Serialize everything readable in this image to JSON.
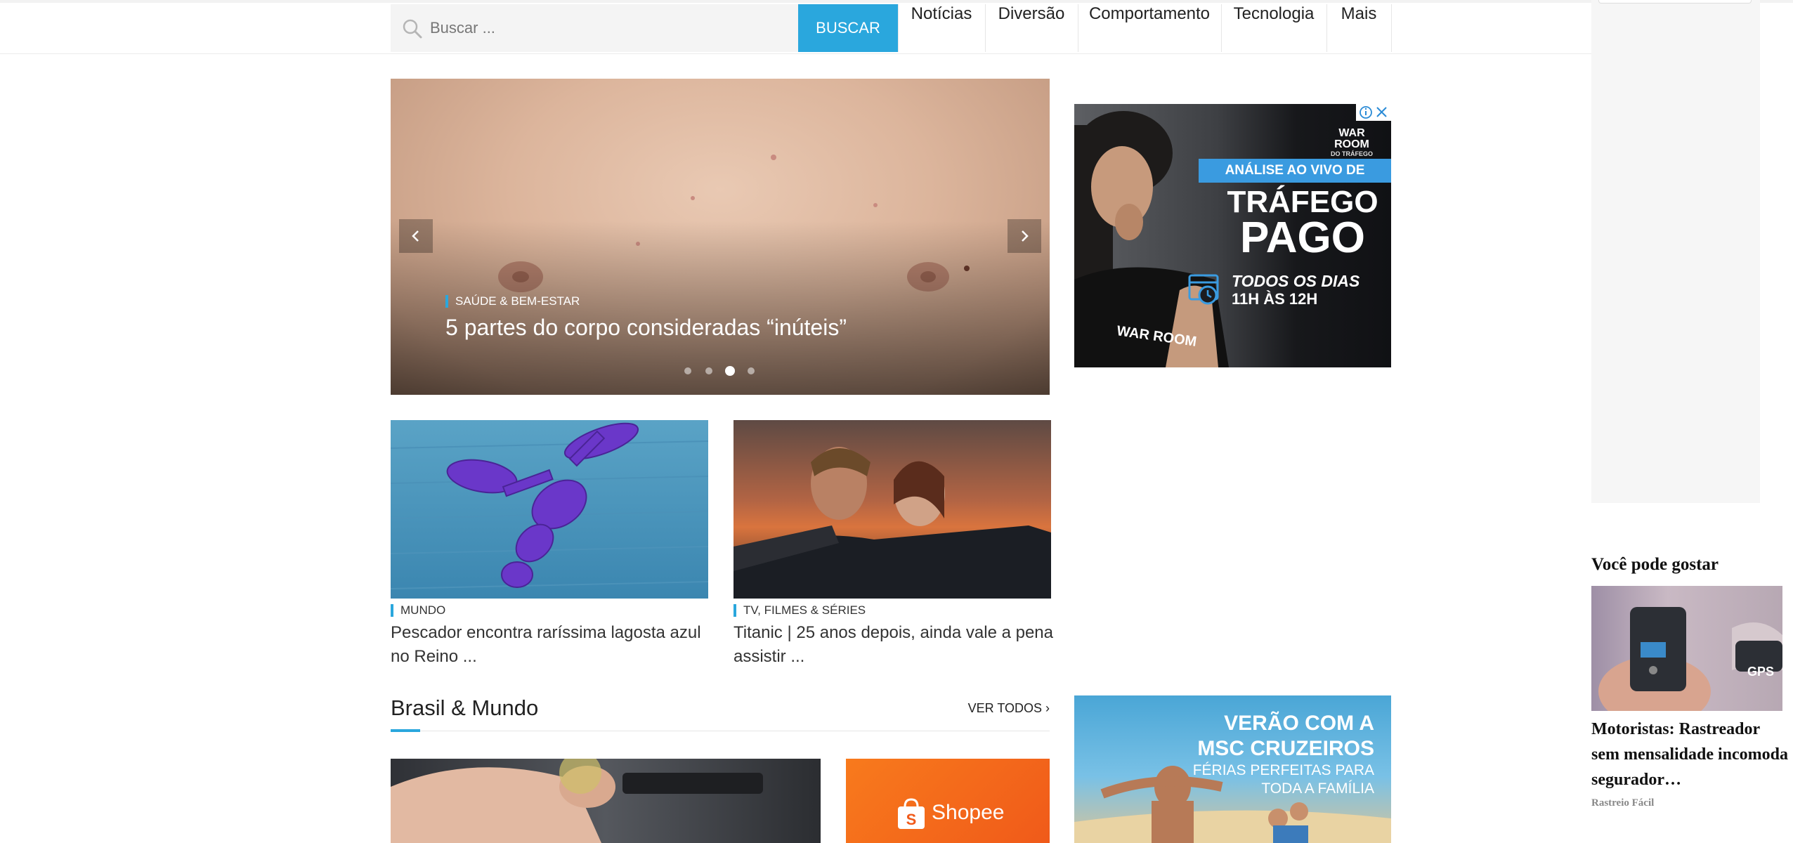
{
  "search": {
    "placeholder": "Buscar ...",
    "button_label": "BUSCAR"
  },
  "nav": {
    "items": [
      "Notícias",
      "Diversão",
      "Comportamento",
      "Tecnologia",
      "Mais"
    ]
  },
  "slider": {
    "category": "SAÚDE & BEM-ESTAR",
    "title": "5 partes do corpo consideradas “inúteis”",
    "dots_total": 4,
    "active_dot": 3
  },
  "ads": {
    "ad1": {
      "brand_line1": "WAR ROOM",
      "brand_line2": "DO TRÁFEGO",
      "banner": "ANÁLISE AO VIVO DE",
      "headline1": "TRÁFEGO",
      "headline2": "PAGO",
      "sub1": "TODOS OS DIAS",
      "sub2": "11H ÀS 12H",
      "shirt_text": "WAR ROOM"
    },
    "ad2": {
      "line1": "VERÃO COM A",
      "line2": "MSC CRUZEIROS",
      "line3": "FÉRIAS PERFEITAS PARA",
      "line4": "TODA A FAMÍLIA"
    }
  },
  "cards": [
    {
      "category": "MUNDO",
      "title": "Pescador encontra raríssima lagosta azul no Reino ..."
    },
    {
      "category": "TV, FILMES & SÉRIES",
      "title": "Titanic | 25 anos depois, ainda vale a pena assistir ..."
    }
  ],
  "section": {
    "title": "Brasil & Mundo",
    "view_all": "VER TODOS ›",
    "shopee_label": "Shopee"
  },
  "recommendations": {
    "heading": "Você pode gostar",
    "item": {
      "title": "Motoristas: Rastreador sem mensalidade incomoda segurador…",
      "source": "Rastreio Fácil",
      "image_label": "GPS"
    }
  },
  "colors": {
    "accent": "#2aa7dd"
  }
}
